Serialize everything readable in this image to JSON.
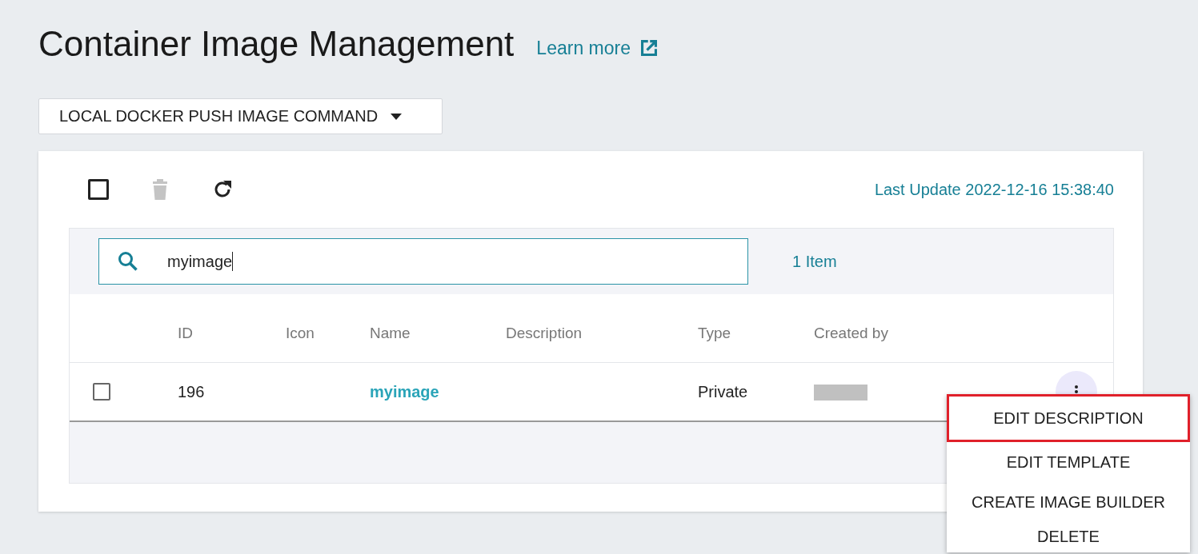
{
  "header": {
    "title": "Container Image Management",
    "link": "Learn more"
  },
  "command_button": {
    "label": "LOCAL DOCKER PUSH IMAGE COMMAND"
  },
  "toolbar": {
    "select_all_checked": false,
    "delete_disabled": true,
    "last_update": "Last Update 2022-12-16 15:38:40"
  },
  "search": {
    "value": "myimage",
    "count": "1 Item"
  },
  "table": {
    "columns": [
      "ID",
      "Icon",
      "Name",
      "Description",
      "Type",
      "Created by"
    ],
    "rows": [
      {
        "checked": false,
        "id": "196",
        "name": "myimage",
        "type": "Private"
      }
    ]
  },
  "menu": {
    "items": [
      {
        "label": "EDIT DESCRIPTION",
        "highlighted": true
      },
      {
        "label": "EDIT TEMPLATE",
        "highlighted": false
      },
      {
        "label": "CREATE IMAGE BUILDER",
        "highlighted": false
      },
      {
        "label": "DELETE",
        "highlighted": false
      }
    ]
  }
}
